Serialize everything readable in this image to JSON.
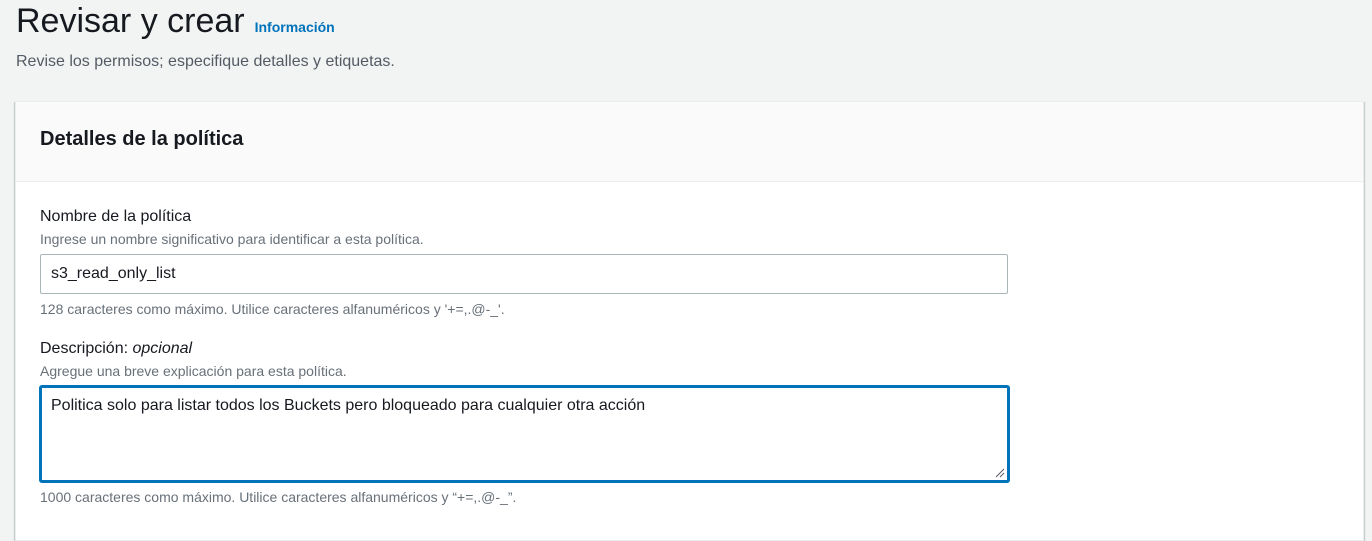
{
  "header": {
    "title": "Revisar y crear",
    "info_link": "Información",
    "description": "Revise los permisos; especifique detalles y etiquetas."
  },
  "policy_details": {
    "section_title": "Detalles de la política",
    "name_field": {
      "label": "Nombre de la política",
      "description": "Ingrese un nombre significativo para identificar a esta política.",
      "value": "s3_read_only_list",
      "constraint": "128 caracteres como máximo. Utilice caracteres alfanuméricos y '+=,.@-_'."
    },
    "description_field": {
      "label": "Descripción:",
      "optional_label": "opcional",
      "description": "Agregue una breve explicación para esta política.",
      "value": "Politica solo para listar todos los Buckets pero bloqueado para cualquier otra acción",
      "constraint": "1000 caracteres como máximo. Utilice caracteres alfanuméricos y “+=,.@-_”."
    }
  },
  "colors": {
    "page_background": "#f2f3f3",
    "link": "#0073bb",
    "focus_border": "#0073bb",
    "text_primary": "#16191f",
    "text_secondary": "#687078"
  }
}
